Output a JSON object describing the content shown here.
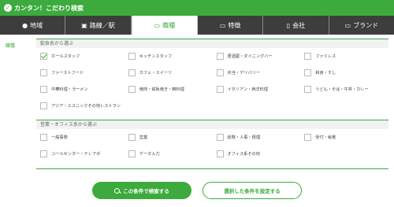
{
  "header": {
    "title": "カンタン！こだわり検索",
    "check_glyph": "✓"
  },
  "tabs": [
    {
      "icon": "location-pin-icon",
      "glyph": "●",
      "label": "地域"
    },
    {
      "icon": "train-icon",
      "glyph": "▣",
      "label": "路線／駅"
    },
    {
      "icon": "briefcase-icon",
      "glyph": "▭",
      "label": "職種",
      "active": true
    },
    {
      "icon": "card-icon",
      "glyph": "▭",
      "label": "特徴"
    },
    {
      "icon": "building-icon",
      "glyph": "▯",
      "label": "会社"
    },
    {
      "icon": "tag-icon",
      "glyph": "▭",
      "label": "ブランド"
    }
  ],
  "side_label": "職種",
  "sections": [
    {
      "title": "飲食系から選ぶ",
      "items": [
        {
          "label": "ホールスタッフ",
          "checked": true
        },
        {
          "label": "キッチンスタッフ",
          "checked": false
        },
        {
          "label": "居酒屋・ダイニングバー",
          "checked": false
        },
        {
          "label": "ファミレス",
          "checked": false
        },
        {
          "label": "ファーストフード",
          "checked": false
        },
        {
          "label": "カフェ・スイーツ",
          "checked": false
        },
        {
          "label": "弁当・デリバリー",
          "checked": false
        },
        {
          "label": "和食・すし",
          "checked": false
        },
        {
          "label": "中華料理・ラーメン",
          "checked": false
        },
        {
          "label": "焼肉・鉄板焼き・韓料理",
          "checked": false
        },
        {
          "label": "イタリアン・西洋料理",
          "checked": false
        },
        {
          "label": "うどん・そば・牛丼・カレー",
          "checked": false
        },
        {
          "label": "アジア・エスニックその他レストラン",
          "checked": false
        }
      ]
    },
    {
      "title": "営業・オフィス系から選ぶ",
      "items": [
        {
          "label": "一般事務",
          "checked": false
        },
        {
          "label": "営業",
          "checked": false
        },
        {
          "label": "総務・人事・経理",
          "checked": false
        },
        {
          "label": "受付・秘書",
          "checked": false
        },
        {
          "label": "コールセンター・テレアポ",
          "checked": false
        },
        {
          "label": "データ入力",
          "checked": false
        },
        {
          "label": "オフィス系その他",
          "checked": false
        }
      ]
    }
  ],
  "buttons": {
    "search_label": "この条件で検索する",
    "set_label": "選択した条件を設定する"
  },
  "colors": {
    "accent": "#3caa3c",
    "tab_bg": "#3d3d3d"
  }
}
